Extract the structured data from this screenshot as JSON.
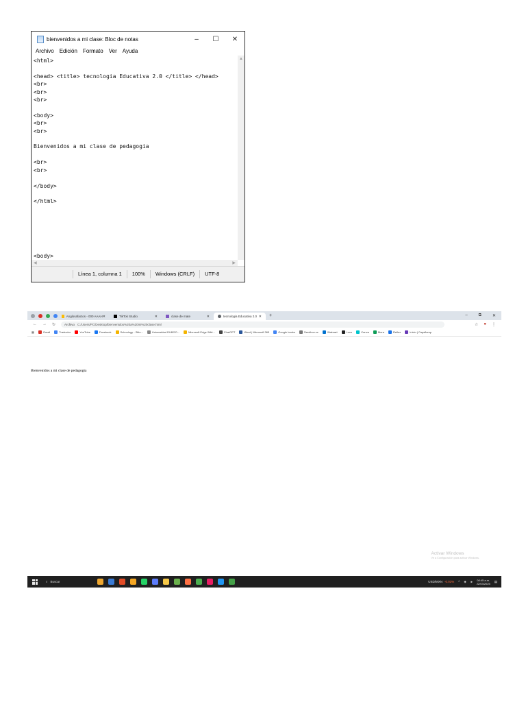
{
  "notepad": {
    "title": "bienvenidos a mi clase: Bloc de notas",
    "window_controls": [
      "–",
      "☐",
      "✕"
    ],
    "menu": [
      "Archivo",
      "Edición",
      "Formato",
      "Ver",
      "Ayuda"
    ],
    "content": "<html>\n\n<head> <title> tecnologia Educativa 2.0 </title> </head>\n<br>\n<br>\n<br>\n\n<body>\n<br>\n<br>\n\nBienvenidos a mi clase de pedagogia\n\n<br>\n<br>\n\n</body>\n\n</html>\n\n\n\n\n\n\n<body>",
    "status": {
      "position": "Línea 1, columna 1",
      "zoom": "100%",
      "line_ending": "Windows (CRLF)",
      "encoding": "UTF-8"
    }
  },
  "browser": {
    "tabs": [
      {
        "label": "Anglosafactos - 000 AAAH",
        "active": false
      },
      {
        "label": "TikTok Studio",
        "active": false
      },
      {
        "label": "clase de mate",
        "active": false
      },
      {
        "label": "tecnologia Educativa 2.0",
        "active": true
      }
    ],
    "window_controls": [
      "–",
      "⧉",
      "✕"
    ],
    "url_prefix": "Archivo",
    "url": "C:/Users/PC/Desktop/bienvenidos%20a%20mi%20clase.html",
    "bookmarks": [
      {
        "label": "Gmail",
        "color": "#d93025"
      },
      {
        "label": "Traductor",
        "color": "#4285f4"
      },
      {
        "label": "YouTube",
        "color": "#ff0000"
      },
      {
        "label": "Facebook",
        "color": "#1877f2"
      },
      {
        "label": "Schoology - Sitio...",
        "color": "#f4b400"
      },
      {
        "label": "Universidad DUBGO...",
        "color": "#888888"
      },
      {
        "label": "Microsoft Edge Wiki...",
        "color": "#f4b400"
      },
      {
        "label": "ChatGPT",
        "color": "#444444"
      },
      {
        "label": "Word | Microsoft 365",
        "color": "#2b579a"
      },
      {
        "label": "Google books",
        "color": "#4285f4"
      },
      {
        "label": "Seedbox.cc",
        "color": "#777777"
      },
      {
        "label": "Walmart",
        "color": "#0071ce"
      },
      {
        "label": "Loco",
        "color": "#222222"
      },
      {
        "label": "Canva",
        "color": "#00c4cc"
      },
      {
        "label": "Mora",
        "color": "#0f9d58"
      },
      {
        "label": "Reflex",
        "color": "#1a73e8"
      },
      {
        "label": "Inicio | Capsflamp",
        "color": "#673ab7"
      }
    ],
    "page_text": "Bienvenidos a mi clase de pedagogia",
    "activate_title": "Activar Windows",
    "activate_sub": "Ve a Configuración para activar Windows."
  },
  "taskbar": {
    "search_placeholder": "Buscar",
    "apps": [
      "#f0a830",
      "#3a7bd5",
      "#e34c26",
      "#f5a623",
      "#25d366",
      "#5c7cfa",
      "#f7c948",
      "#6ab04c",
      "#ff7043",
      "#4caf50",
      "#e91e63",
      "#2196f3",
      "#43a047"
    ],
    "weather": "USD/MXN",
    "weather_change": "-0.03%",
    "clock_time": "08:45 a.m.",
    "clock_date": "22/03/2025"
  }
}
